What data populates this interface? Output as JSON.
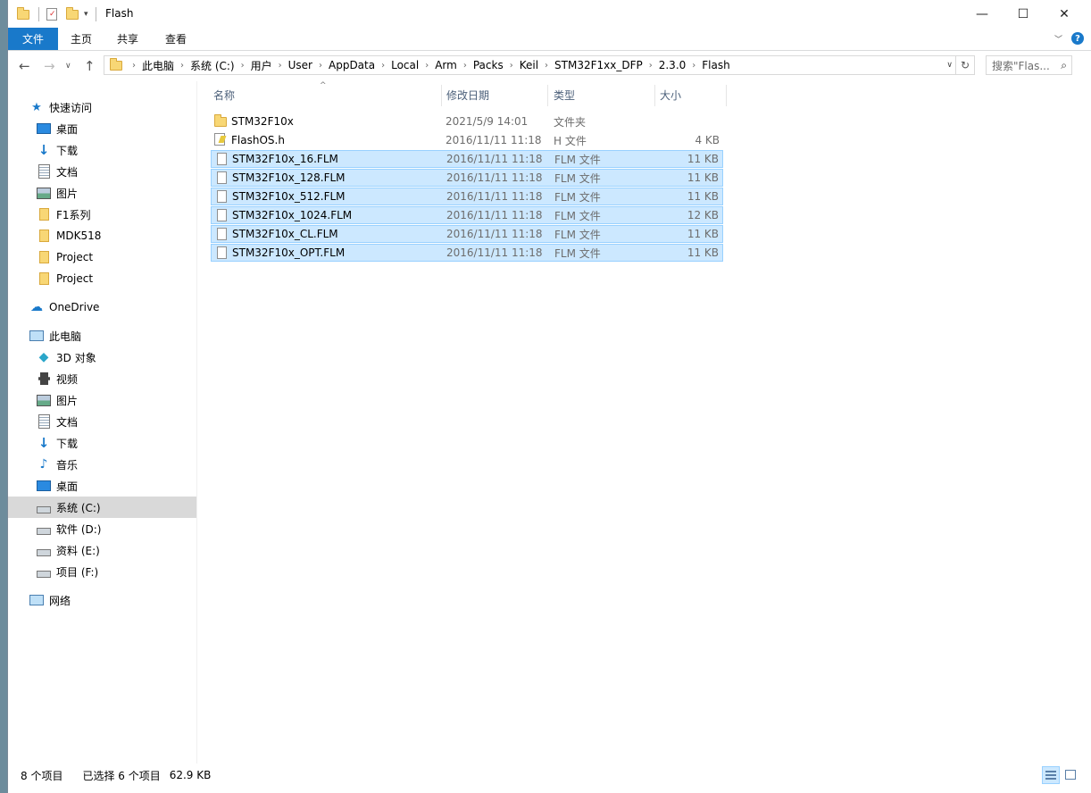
{
  "window": {
    "title": "Flash",
    "controls": {
      "minimize": "—",
      "maximize": "☐",
      "close": "✕"
    }
  },
  "ribbon": {
    "file_tab": "文件",
    "tabs": [
      "主页",
      "共享",
      "查看"
    ]
  },
  "address": {
    "crumbs": [
      "此电脑",
      "系统 (C:)",
      "用户",
      "User",
      "AppData",
      "Local",
      "Arm",
      "Packs",
      "Keil",
      "STM32F1xx_DFP",
      "2.3.0",
      "Flash"
    ]
  },
  "search": {
    "placeholder": "搜索\"Flas..."
  },
  "nav": {
    "quick_access": "快速访问",
    "quick_items": [
      "桌面",
      "下载",
      "文档",
      "图片",
      "F1系列",
      "MDK518",
      "Project",
      "Project"
    ],
    "onedrive": "OneDrive",
    "this_pc": "此电脑",
    "pc_items": [
      "3D 对象",
      "视频",
      "图片",
      "文档",
      "下载",
      "音乐",
      "桌面",
      "系统 (C:)",
      "软件 (D:)",
      "资料 (E:)",
      "项目 (F:)"
    ],
    "network": "网络"
  },
  "columns": {
    "name": "名称",
    "date": "修改日期",
    "type": "类型",
    "size": "大小"
  },
  "files": [
    {
      "name": "STM32F10x",
      "date": "2021/5/9 14:01",
      "type": "文件夹",
      "size": "",
      "kind": "folder",
      "selected": false
    },
    {
      "name": "FlashOS.h",
      "date": "2016/11/11 11:18",
      "type": "H 文件",
      "size": "4 KB",
      "kind": "h",
      "selected": false
    },
    {
      "name": "STM32F10x_16.FLM",
      "date": "2016/11/11 11:18",
      "type": "FLM 文件",
      "size": "11 KB",
      "kind": "file",
      "selected": true
    },
    {
      "name": "STM32F10x_128.FLM",
      "date": "2016/11/11 11:18",
      "type": "FLM 文件",
      "size": "11 KB",
      "kind": "file",
      "selected": true
    },
    {
      "name": "STM32F10x_512.FLM",
      "date": "2016/11/11 11:18",
      "type": "FLM 文件",
      "size": "11 KB",
      "kind": "file",
      "selected": true
    },
    {
      "name": "STM32F10x_1024.FLM",
      "date": "2016/11/11 11:18",
      "type": "FLM 文件",
      "size": "12 KB",
      "kind": "file",
      "selected": true
    },
    {
      "name": "STM32F10x_CL.FLM",
      "date": "2016/11/11 11:18",
      "type": "FLM 文件",
      "size": "11 KB",
      "kind": "file",
      "selected": true
    },
    {
      "name": "STM32F10x_OPT.FLM",
      "date": "2016/11/11 11:18",
      "type": "FLM 文件",
      "size": "11 KB",
      "kind": "file",
      "selected": true
    }
  ],
  "status": {
    "count": "8 个项目",
    "selected": "已选择 6 个项目",
    "size": "62.9 KB"
  },
  "colors": {
    "accent": "#1979ca",
    "selection": "#cce8ff",
    "selection_border": "#99d1ff",
    "folder": "#f8d775"
  }
}
